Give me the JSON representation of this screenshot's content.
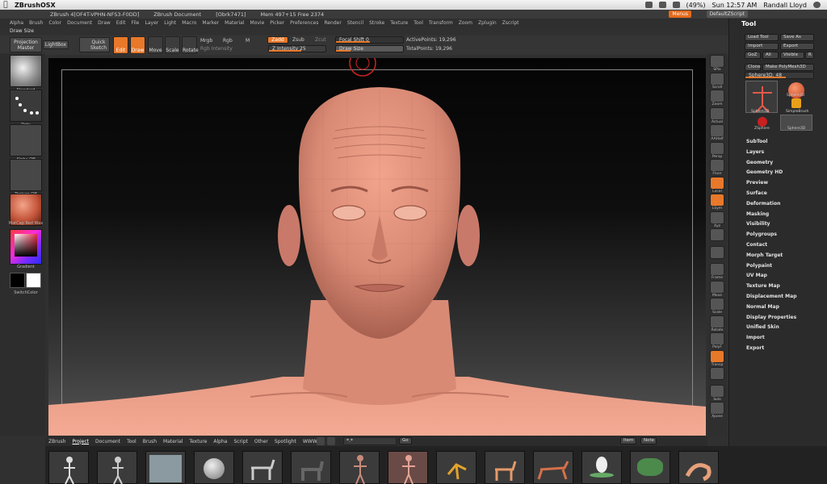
{
  "macbar": {
    "app_name": "ZBrushOSX",
    "clock": "Sun 12:57 AM",
    "user": "Randall Lloyd",
    "battery": "(49%)"
  },
  "titlebar": {
    "program": "ZBrush 4[OF4T-VPHN-NFS3-F0DD]",
    "document": "ZBrush Document",
    "mem": "[Obrk7471]",
    "mem_info": "Mem 497+15  Free 2374",
    "menus_label": "Menus",
    "script_label": "DefaultZScript"
  },
  "menus": [
    "Alpha",
    "Brush",
    "Color",
    "Document",
    "Draw",
    "Edit",
    "File",
    "Layer",
    "Light",
    "Macro",
    "Marker",
    "Material",
    "Movie",
    "Picker",
    "Preferences",
    "Render",
    "Stencil",
    "Stroke",
    "Texture",
    "Tool",
    "Transform",
    "Zoom",
    "Zplugin",
    "Zscript"
  ],
  "draw_size_label": "Draw Size",
  "shelf": {
    "projection_master": "Projection Master",
    "lightbox": "LightBox",
    "quick_sketch": "Quick Sketch",
    "edit": "Edit",
    "draw": "Draw",
    "move": "Move",
    "scale": "Scale",
    "rotate": "Rotate",
    "mrgb": "Mrgb",
    "rgb": "Rgb",
    "m": "M",
    "rgb_intensity": "Rgb Intensity",
    "zadd": "Zadd",
    "zsub": "Zsub",
    "zcut": "Zcut",
    "z_intensity": "Z Intensity 25",
    "focal_shift": "Focal Shift 0",
    "draw_size": "Draw Size",
    "active_points": "ActivePoints: 19,296",
    "total_points": "TotalPoints: 19,296"
  },
  "left_tray": [
    {
      "label": "Standard"
    },
    {
      "label": "Dots"
    },
    {
      "label": "Alpha Off"
    },
    {
      "label": "Texture Off"
    },
    {
      "label": "MatCap Red Wax"
    },
    {
      "label": "Gradient"
    },
    {
      "label": "SwitchColor"
    }
  ],
  "right_shelf": [
    "SPix",
    "Scroll",
    "Zoom",
    "Actual",
    "AAHalf",
    "Persp",
    "Floor",
    "Local",
    "LSym",
    "Xyz",
    "",
    "",
    "Frame",
    "Move",
    "Scale",
    "Rotate",
    "PolyF",
    "Transp",
    "",
    "Solo",
    "Xpose"
  ],
  "tool": {
    "title": "Tool",
    "load_tool": "Load Tool",
    "save_as": "Save As",
    "import": "Import",
    "export": "Export",
    "goz": "GoZ",
    "all": "All",
    "visible": "Visible",
    "r": "R",
    "clone": "Clone",
    "make_polymesh": "Make PolyMesh3D",
    "current": "Sphere3D. 48",
    "thumbs": [
      "Sphere3D",
      "Sphere3D",
      "SimpleBrush",
      "ZSphere",
      "Sphere3D"
    ],
    "sections": [
      "SubTool",
      "Layers",
      "Geometry",
      "Geometry HD",
      "Preview",
      "Surface",
      "Deformation",
      "Masking",
      "Visibility",
      "Polygroups",
      "Contact",
      "Morph Target",
      "Polypaint",
      "UV Map",
      "Texture Map",
      "Displacement Map",
      "Normal Map",
      "Display Properties",
      "Unified Skin",
      "Import",
      "Export"
    ]
  },
  "bottom": {
    "tabs": [
      "ZBrush",
      "Project",
      "Document",
      "Tool",
      "Brush",
      "Material",
      "Texture",
      "Alpha",
      "Script",
      "Other",
      "Spotlight",
      "WWW"
    ],
    "active_tab": "Project",
    "search_value": "*.*",
    "go": "Go",
    "item": "Item",
    "note": "Note"
  },
  "colors": {
    "accent": "#e8782a",
    "skin": "#d98a75",
    "panel": "#2b2b2b"
  }
}
